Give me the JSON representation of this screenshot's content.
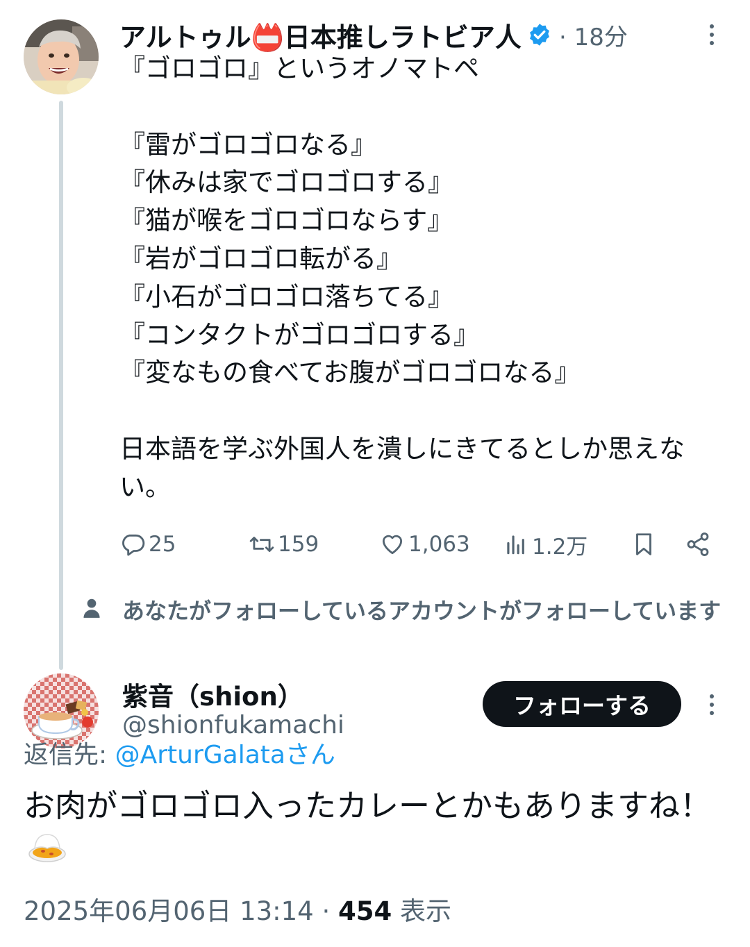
{
  "tweet1": {
    "author_name": "アルトゥル📛日本推しラトビア人",
    "separator": "·",
    "time": "18分",
    "body": "『ゴロゴロ』というオノマトペ\n\n『雷がゴロゴロなる』\n『休みは家でゴロゴロする』\n『猫が喉をゴロゴロならす』\n『岩がゴロゴロ転がる』\n『小石がゴロゴロ落ちてる』\n『コンタクトがゴロゴロする』\n『変なもの食べてお腹がゴロゴロなる』\n\n日本語を学ぶ外国人を潰しにきてるとしか思えない。",
    "actions": {
      "replies": "25",
      "retweets": "159",
      "likes": "1,063",
      "views": "1.2万"
    }
  },
  "social_context": "あなたがフォローしているアカウントがフォローしています",
  "tweet2": {
    "author_name": "紫音（shion）",
    "handle": "@shionfukamachi",
    "follow_label": "フォローする",
    "reply_prefix": "返信先: ",
    "reply_target": "@ArturGalataさん",
    "body": "お肉がゴロゴロ入ったカレーとかもありますね！",
    "timestamp": "2025年06月06日 13:14 · ",
    "views_count": "454",
    "views_label": " 表示"
  },
  "colors": {
    "text": "#0f1419",
    "secondary": "#536471",
    "link": "#1d9bf0",
    "verified": "#1d9bf0",
    "thread_line": "#cfd9de"
  }
}
